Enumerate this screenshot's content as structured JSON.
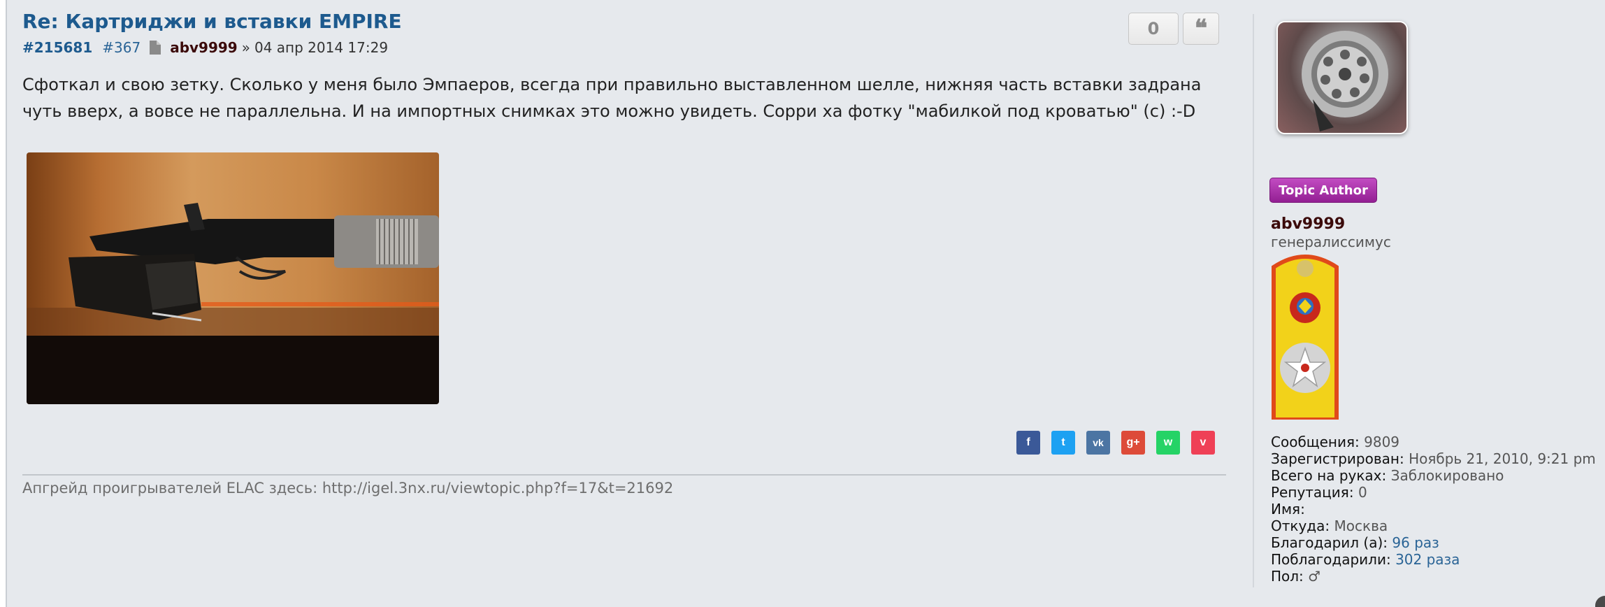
{
  "post": {
    "title": "Re: Картриджи и вставки EMPIRE",
    "id": "#215681",
    "number": "#367",
    "author": "abv9999",
    "separator": "»",
    "date": "04 апр 2014 17:29",
    "vote_count": "0",
    "quote_glyph": "❝",
    "body": "Сфоткал и свою зетку. Сколько у меня было Эмпаеров, всегда при правильно выставленном шелле, нижняя часть вставки задрана чуть вверх, а вовсе не параллельна. И на импортных снимках это можно увидеть. Сорри ха фотку \"мабилкой под кроватью\" (с) :-D",
    "signature": "Апгрейд проигрывателей ELAC здесь: http://igel.3nx.ru/viewtopic.php?f=17&t=21692"
  },
  "share": [
    {
      "icon": "facebook-icon",
      "glyph": "f",
      "color": "#3b5998"
    },
    {
      "icon": "twitter-icon",
      "glyph": "t",
      "color": "#1da1f2"
    },
    {
      "icon": "vk-icon",
      "glyph": "vk",
      "color": "#4c75a3"
    },
    {
      "icon": "googleplus-icon",
      "glyph": "g+",
      "color": "#dd4b39"
    },
    {
      "icon": "whatsapp-icon",
      "glyph": "w",
      "color": "#25d366"
    },
    {
      "icon": "pocket-icon",
      "glyph": "v",
      "color": "#ef4056"
    }
  ],
  "profile": {
    "badge": "Topic Author",
    "username": "abv9999",
    "rank": "генералиссимус",
    "stats": [
      {
        "label": "Сообщения:",
        "value": "9809"
      },
      {
        "label": "Зарегистрирован:",
        "value": "Ноябрь 21, 2010, 9:21 pm"
      },
      {
        "label": "Всего на руках:",
        "value": "Заблокировано"
      },
      {
        "label": "Репутация:",
        "value": "0"
      },
      {
        "label": "Имя:",
        "value": ""
      },
      {
        "label": "Откуда:",
        "value": "Москва"
      },
      {
        "label": "Благодарил (а):",
        "value": "96 раз"
      },
      {
        "label": "Поблагодарили:",
        "value": "302 раза"
      },
      {
        "label": "Пол:",
        "value": "♂"
      }
    ]
  }
}
